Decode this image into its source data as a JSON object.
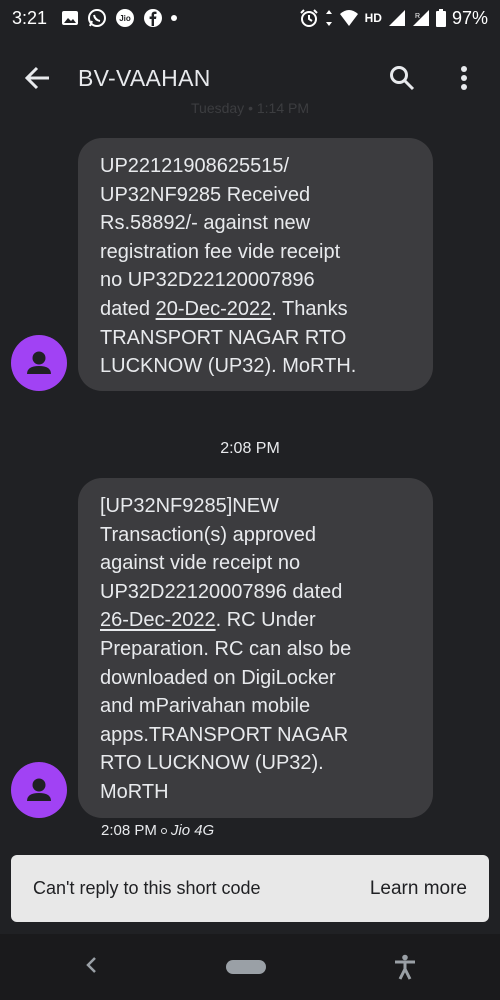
{
  "status_bar": {
    "time": "3:21",
    "network_label": "HD",
    "battery": "97%",
    "icons": [
      "gallery-icon",
      "whatsapp-icon",
      "jio-icon",
      "facebook-icon",
      "alarm-icon",
      "wifi-icon",
      "signal-icon",
      "battery-icon"
    ]
  },
  "app_bar": {
    "title": "BV-VAAHAN",
    "icons": [
      "back-arrow-icon",
      "search-icon",
      "more-vert-icon"
    ]
  },
  "conversation": {
    "faded_header": "Tuesday • 1:14 PM",
    "messages": [
      {
        "text_before": "UP22121908625515/\nUP32NF9285 Received\nRs.58892/- against new\nregistration fee vide receipt\nno UP32D22120007896\ndated ",
        "link": "20-Dec-2022",
        "text_after": ". Thanks\nTRANSPORT NAGAR RTO\nLUCKNOW (UP32). MoRTH."
      },
      {
        "time_divider": "2:08 PM",
        "text_before": "[UP32NF9285]NEW\nTransaction(s) approved\nagainst vide receipt no\nUP32D22120007896 dated\n",
        "link": "26-Dec-2022",
        "text_after": ". RC Under\nPreparation. RC can also be\ndownloaded on DigiLocker\nand mParivahan mobile\napps.TRANSPORT NAGAR\nRTO LUCKNOW (UP32).\nMoRTH",
        "meta_time": "2:08 PM",
        "meta_network": "Jio 4G"
      }
    ]
  },
  "reply_bar": {
    "message": "Can't reply to this short code",
    "action": "Learn more"
  },
  "colors": {
    "background": "#202124",
    "bubble": "#3c3c3f",
    "avatar": "#a142f4",
    "reply_bar": "#e8e8e8"
  }
}
